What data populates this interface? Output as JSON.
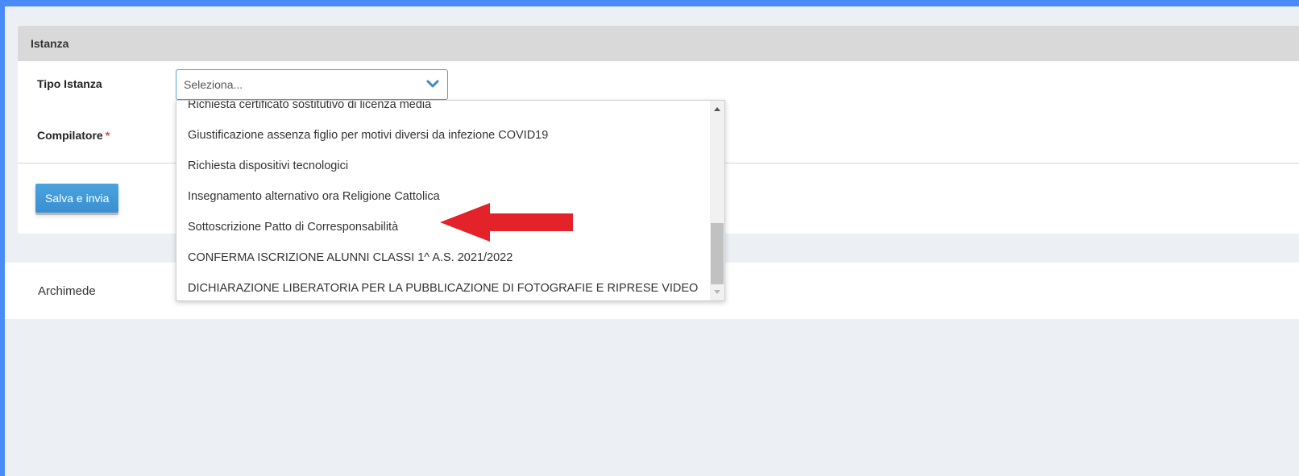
{
  "panel": {
    "title": "Istanza",
    "tipo_label": "Tipo Istanza",
    "compilatore_label": "Compilatore",
    "required_mark": "*",
    "select_placeholder": "Seleziona...",
    "save_label": "Salva e invia"
  },
  "dropdown": {
    "options": [
      "Richiesta certificato sostitutivo di licenza media",
      "Giustificazione assenza figlio per motivi diversi da infezione COVID19",
      "Richiesta dispositivi tecnologici",
      "Insegnamento alternativo ora Religione Cattolica",
      "Sottoscrizione Patto di Corresponsabilità",
      "CONFERMA ISCRIZIONE ALUNNI CLASSI 1^ A.S. 2021/2022",
      "DICHIARAZIONE LIBERATORIA PER LA PUBBLICAZIONE DI FOTOGRAFIE E RIPRESE VIDEO"
    ],
    "highlighted_index": 4
  },
  "footer": {
    "text": "Archimede"
  },
  "colors": {
    "page_border": "#4a8cf7",
    "background": "#ecf0f5",
    "header_gray": "#d9d9d9",
    "button_blue": "#3c8dbc",
    "select_border": "#5b9bd5",
    "arrow_red": "#e3222a",
    "required_red": "#dd4b39"
  },
  "icons": {
    "select_chevron": "chevron-down-icon",
    "annotation_arrow": "red-arrow-left-icon"
  }
}
